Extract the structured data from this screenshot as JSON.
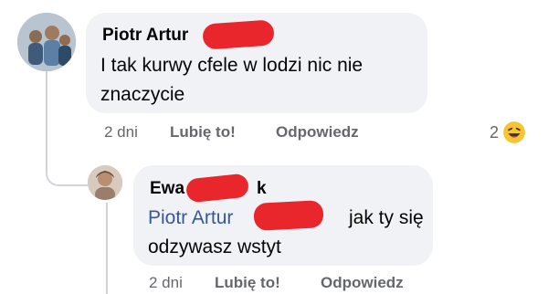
{
  "comments": [
    {
      "author": "Piotr Artur",
      "text_line1": "I tak kurwy cfele w lodzi nic nie",
      "text_line2": "znaczycie",
      "time": "2 dni",
      "like_label": "Lubię to!",
      "reply_label": "Odpowiedz",
      "reaction_count": "2",
      "reaction_icon": "haha-emoji-icon"
    },
    {
      "author": "Ewa",
      "author_suffix": "k",
      "mention": "Piotr Artur",
      "text_after_mention": "jak ty się",
      "text_line2": "odzywasz wstyt",
      "time": "2 dni",
      "like_label": "Lubię to!",
      "reply_label": "Odpowiedz"
    }
  ],
  "colors": {
    "bubble": "#f0f2f5",
    "redaction": "#e8262b",
    "mention": "#385898",
    "meta": "#65676b"
  }
}
